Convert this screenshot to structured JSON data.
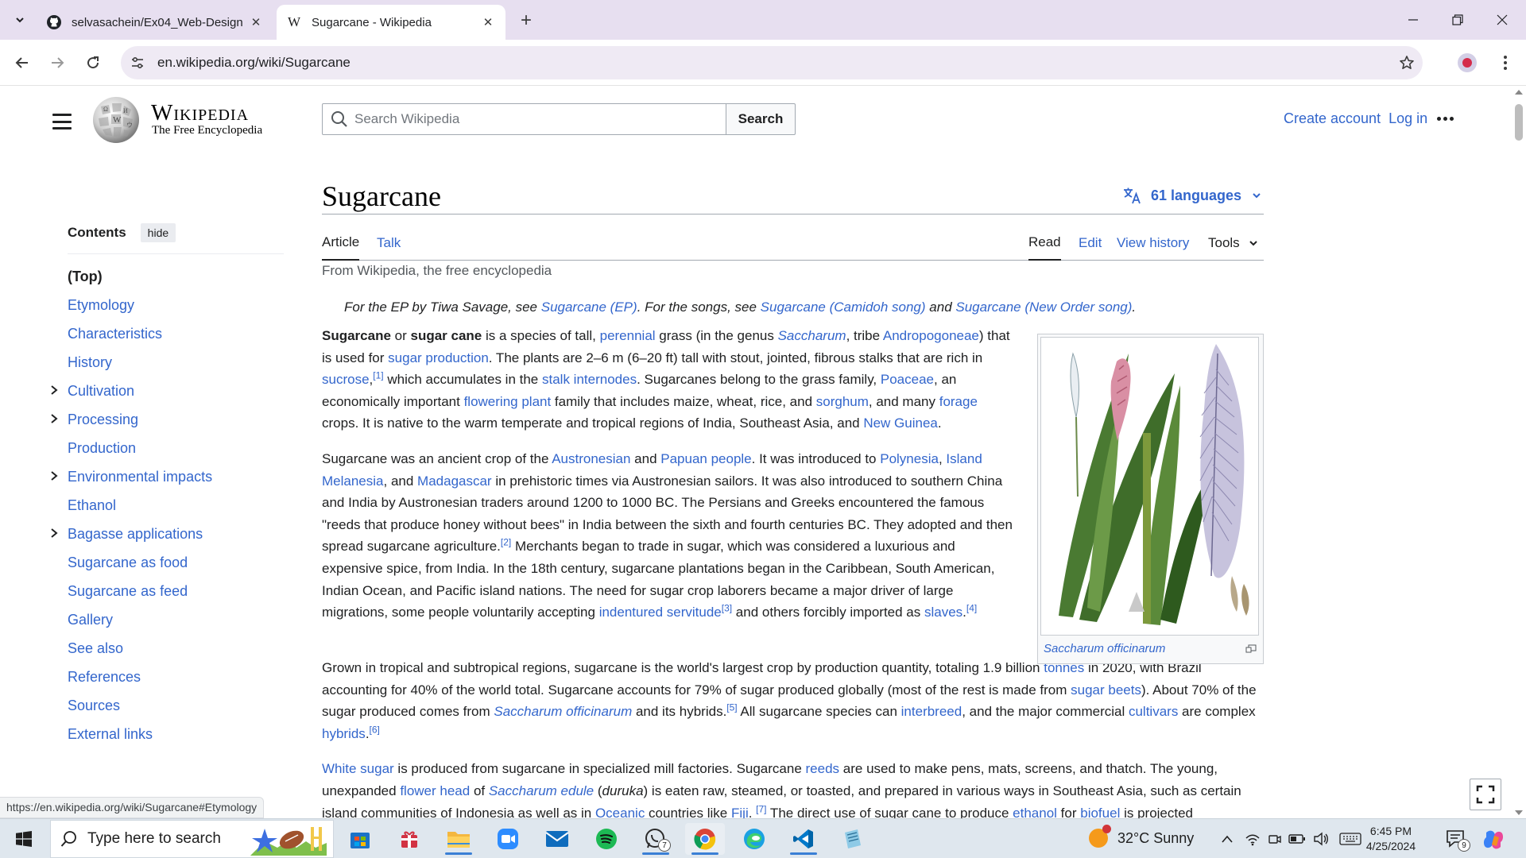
{
  "browser": {
    "tabs": [
      {
        "title": "selvasachein/Ex04_Web-Design",
        "favicon": "github-icon"
      },
      {
        "title": "Sugarcane - Wikipedia",
        "favicon": "wikipedia-icon",
        "active": true
      }
    ],
    "url": "en.wikipedia.org/wiki/Sugarcane"
  },
  "wiki": {
    "wordmark": "Wikipedia",
    "tagline": "The Free Encyclopedia",
    "search_placeholder": "Search Wikipedia",
    "search_button": "Search",
    "create_account": "Create account",
    "log_in": "Log in"
  },
  "toc": {
    "title": "Contents",
    "hide": "hide",
    "items": [
      {
        "label": "(Top)",
        "expandable": false
      },
      {
        "label": "Etymology",
        "expandable": false
      },
      {
        "label": "Characteristics",
        "expandable": false
      },
      {
        "label": "History",
        "expandable": false
      },
      {
        "label": "Cultivation",
        "expandable": true
      },
      {
        "label": "Processing",
        "expandable": true
      },
      {
        "label": "Production",
        "expandable": false
      },
      {
        "label": "Environmental impacts",
        "expandable": true
      },
      {
        "label": "Ethanol",
        "expandable": false
      },
      {
        "label": "Bagasse applications",
        "expandable": true
      },
      {
        "label": "Sugarcane as food",
        "expandable": false
      },
      {
        "label": "Sugarcane as feed",
        "expandable": false
      },
      {
        "label": "Gallery",
        "expandable": false
      },
      {
        "label": "See also",
        "expandable": false
      },
      {
        "label": "References",
        "expandable": false
      },
      {
        "label": "Sources",
        "expandable": false
      },
      {
        "label": "External links",
        "expandable": false
      }
    ]
  },
  "article": {
    "title": "Sugarcane",
    "languages": "61 languages",
    "tabs": {
      "article": "Article",
      "talk": "Talk",
      "read": "Read",
      "edit": "Edit",
      "history": "View history",
      "tools": "Tools"
    },
    "from": "From Wikipedia, the free encyclopedia",
    "hatnote": {
      "t1": "For the EP by Tiwa Savage, see ",
      "l1": "Sugarcane (EP)",
      "t2": ". For the songs, see ",
      "l2": "Sugarcane (Camidoh song)",
      "t3": " and ",
      "l3": "Sugarcane (New Order song)",
      "t4": "."
    },
    "infobox_caption": "Saccharum officinarum"
  },
  "status_url": "https://en.wikipedia.org/wiki/Sugarcane#Etymology",
  "taskbar": {
    "search_label": "Type here to search",
    "weather": "32°C  Sunny",
    "time": "6:45 PM",
    "date": "4/25/2024",
    "whatsapp_badge": "7",
    "notif_count": "9"
  },
  "colors": {
    "link": "#3366cc",
    "tabbar": "#e7dff0",
    "taskbar": "#dfe7ee"
  }
}
